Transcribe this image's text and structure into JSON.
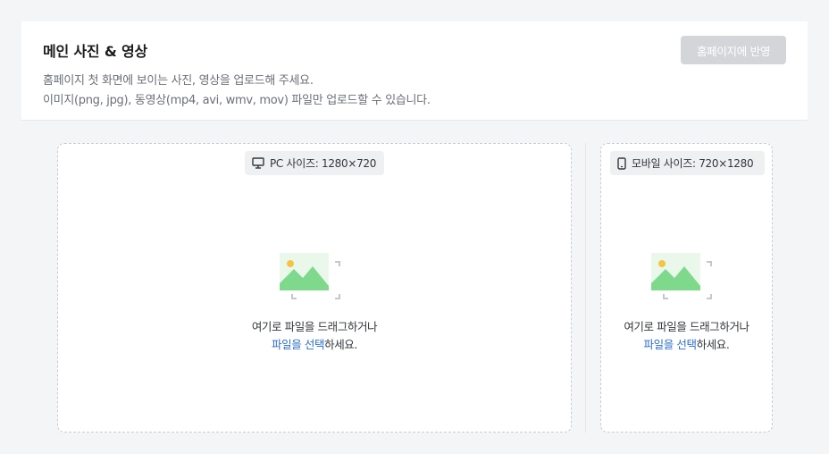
{
  "header": {
    "title": "메인 사진 & 영상",
    "description_line1": "홈페이지 첫 화면에 보이는 사진, 영상을 업로드해 주세요.",
    "description_line2": "이미지(png, jpg), 동영상(mp4, avi, wmv, mov) 파일만 업로드할 수 있습니다.",
    "apply_button_label": "홈페이지에 반영"
  },
  "pc_zone": {
    "size_label": "PC 사이즈: 1280×720",
    "icon": "monitor-icon",
    "drop_text": "여기로 파일을 드래그하거나",
    "select_link": "파일을 선택",
    "select_suffix": "하세요."
  },
  "mobile_zone": {
    "size_label": "모바일 사이즈: 720×1280",
    "icon": "smartphone-icon",
    "drop_text": "여기로 파일을 드래그하거나",
    "select_link": "파일을 선택",
    "select_suffix": "하세요."
  },
  "colors": {
    "background": "#f4f5f7",
    "disabled_button": "#d3d5d9",
    "link": "#2f6ecb",
    "illustration_green": "#7fd98c",
    "illustration_sun": "#f5c542"
  }
}
